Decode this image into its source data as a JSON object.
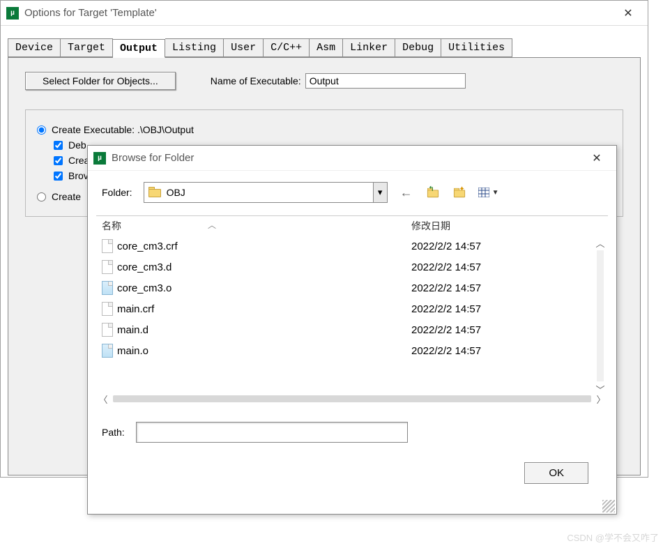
{
  "mainWindow": {
    "title": "Options for Target 'Template'"
  },
  "tabs": [
    "Device",
    "Target",
    "Output",
    "Listing",
    "User",
    "C/C++",
    "Asm",
    "Linker",
    "Debug",
    "Utilities"
  ],
  "activeTab": "Output",
  "outputTab": {
    "selectFolderBtn": "Select Folder for Objects...",
    "nameLabel": "Name of Executable:",
    "nameValue": "Output",
    "radioExecLabel": "Create Executable:  .\\OBJ\\Output",
    "chkDebug": "Deb",
    "chkCreate": "Crea",
    "chkBrowse": "Brov",
    "radioLibLabel": "Create"
  },
  "browseDialog": {
    "title": "Browse for Folder",
    "folderLabel": "Folder:",
    "folderValue": "OBJ",
    "colName": "名称",
    "colDate": "修改日期",
    "files": [
      {
        "name": "core_cm3.crf",
        "date": "2022/2/2 14:57",
        "type": "doc"
      },
      {
        "name": "core_cm3.d",
        "date": "2022/2/2 14:57",
        "type": "doc"
      },
      {
        "name": "core_cm3.o",
        "date": "2022/2/2 14:57",
        "type": "obj"
      },
      {
        "name": "main.crf",
        "date": "2022/2/2 14:57",
        "type": "doc"
      },
      {
        "name": "main.d",
        "date": "2022/2/2 14:57",
        "type": "doc"
      },
      {
        "name": "main.o",
        "date": "2022/2/2 14:57",
        "type": "obj"
      }
    ],
    "pathLabel": "Path:",
    "pathValue": "",
    "okLabel": "OK"
  },
  "watermark": "CSDN @学不会又咋了"
}
